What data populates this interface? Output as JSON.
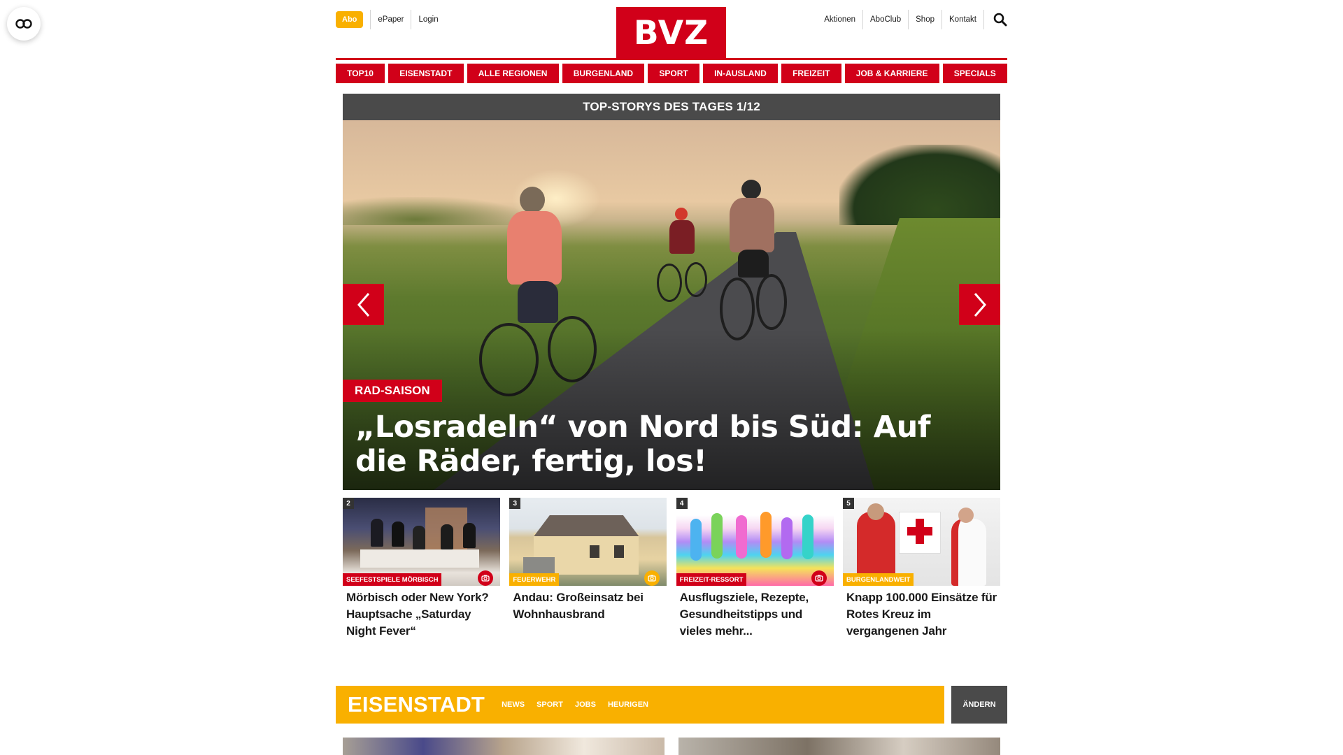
{
  "header": {
    "abo": "Abo",
    "left_links": [
      "ePaper",
      "Login"
    ],
    "logo": "BVZ",
    "right_links": [
      "Aktionen",
      "AboClub",
      "Shop",
      "Kontakt"
    ]
  },
  "nav": [
    "TOP10",
    "EISENSTADT",
    "ALLE REGIONEN",
    "BURGENLAND",
    "SPORT",
    "IN-AUSLAND",
    "FREIZEIT",
    "JOB & KARRIERE",
    "SPECIALS"
  ],
  "hero": {
    "heading": "TOP-STORYS DES TAGES 1/12",
    "kicker": "RAD-SAISON",
    "title": "„Losradeln“ von Nord bis Süd: Auf die Räder, fertig, los!"
  },
  "teasers": [
    {
      "number": "2",
      "tag": "SEEFESTSPIELE MÖRBISCH",
      "title": "Mörbisch oder New York? Hauptsache „Saturday Night Fever“"
    },
    {
      "number": "3",
      "tag": "FEUERWEHR",
      "title": "Andau: Großeinsatz bei Wohnhausbrand"
    },
    {
      "number": "4",
      "tag": "FREIZEIT-RESSORT",
      "title": "Ausflugsziele, Rezepte, Gesundheitstipps und vieles mehr..."
    },
    {
      "number": "5",
      "tag": "BURGENLANDWEIT",
      "title": "Knapp 100.000 Einsätze für Rotes Kreuz im vergangenen Jahr"
    }
  ],
  "region": {
    "title": "EISENSTADT",
    "links": [
      "NEWS",
      "SPORT",
      "JOBS",
      "HEURIGEN"
    ],
    "change": "ÄNDERN"
  },
  "colors": {
    "brand_red": "#d10019",
    "accent_yellow": "#f9b000",
    "dark_grey": "#4a4a4a"
  },
  "icons": {
    "accessibility": "infinity-glasses-icon",
    "search": "magnifier-icon",
    "prev": "chevron-left-icon",
    "next": "chevron-right-icon",
    "gallery": "camera-icon"
  }
}
